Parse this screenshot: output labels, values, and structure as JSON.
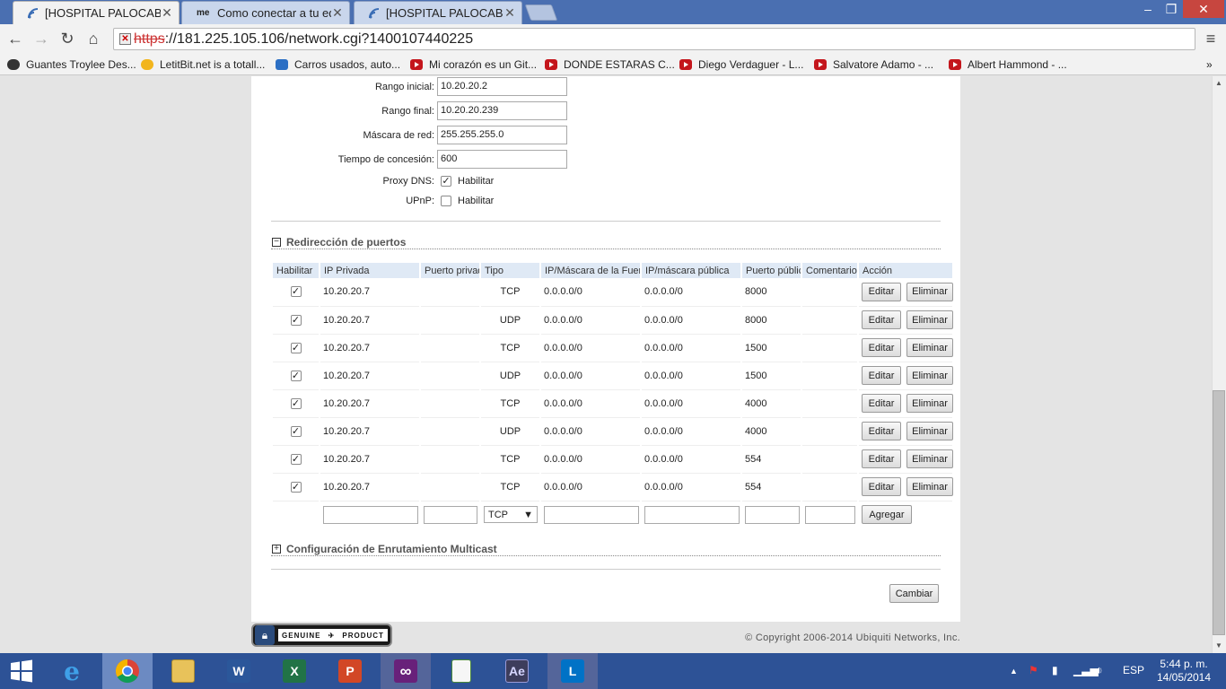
{
  "browser": {
    "tabs": [
      {
        "title": "[HOSPITAL PALOCABILDO",
        "icon": "signal-icon",
        "active": true
      },
      {
        "title": "Como conectar a tu equip",
        "icon": "me-icon",
        "active": false
      },
      {
        "title": "[HOSPITAL PALOCABILDO",
        "icon": "signal-icon",
        "active": false
      }
    ],
    "window_controls": {
      "minimize": "–",
      "restore": "❐",
      "close": "✕"
    },
    "url_protocol": "https",
    "url_rest": "://181.225.105.106/network.cgi?1400107440225",
    "bookmarks": [
      "Guantes Troylee Des...",
      "LetitBit.net is a totall...",
      "Carros usados, auto...",
      "Mi corazón es un Git...",
      "DONDE ESTARAS C...",
      "Diego Verdaguer - L...",
      "Salvatore Adamo - ...",
      "Albert Hammond - ..."
    ],
    "bookmarks_overflow": "»"
  },
  "dhcp": {
    "range_start_label": "Rango inicial:",
    "range_start_value": "10.20.20.2",
    "range_end_label": "Rango final:",
    "range_end_value": "10.20.20.239",
    "netmask_label": "Máscara de red:",
    "netmask_value": "255.255.255.0",
    "lease_label": "Tiempo de concesión:",
    "lease_value": "600",
    "dns_proxy_label": "Proxy DNS:",
    "dns_proxy_checked": true,
    "upnp_label": "UPnP:",
    "upnp_checked": false,
    "enable_text": "Habilitar"
  },
  "port_forward": {
    "section_title": "Redirección de puertos",
    "headers": [
      "Habilitar",
      "IP Privada",
      "Puerto privado",
      "Tipo",
      "IP/Máscara de la Fuente",
      "IP/máscara pública",
      "Puerto público",
      "Comentario",
      "Acción"
    ],
    "rows": [
      {
        "enabled": true,
        "ip": "10.20.20.7",
        "private_port": "",
        "type": "TCP",
        "source": "0.0.0.0/0",
        "public_ip": "0.0.0.0/0",
        "public_port": "8000",
        "comment": ""
      },
      {
        "enabled": true,
        "ip": "10.20.20.7",
        "private_port": "",
        "type": "UDP",
        "source": "0.0.0.0/0",
        "public_ip": "0.0.0.0/0",
        "public_port": "8000",
        "comment": ""
      },
      {
        "enabled": true,
        "ip": "10.20.20.7",
        "private_port": "",
        "type": "TCP",
        "source": "0.0.0.0/0",
        "public_ip": "0.0.0.0/0",
        "public_port": "1500",
        "comment": ""
      },
      {
        "enabled": true,
        "ip": "10.20.20.7",
        "private_port": "",
        "type": "UDP",
        "source": "0.0.0.0/0",
        "public_ip": "0.0.0.0/0",
        "public_port": "1500",
        "comment": ""
      },
      {
        "enabled": true,
        "ip": "10.20.20.7",
        "private_port": "",
        "type": "TCP",
        "source": "0.0.0.0/0",
        "public_ip": "0.0.0.0/0",
        "public_port": "4000",
        "comment": ""
      },
      {
        "enabled": true,
        "ip": "10.20.20.7",
        "private_port": "",
        "type": "UDP",
        "source": "0.0.0.0/0",
        "public_ip": "0.0.0.0/0",
        "public_port": "4000",
        "comment": ""
      },
      {
        "enabled": true,
        "ip": "10.20.20.7",
        "private_port": "",
        "type": "TCP",
        "source": "0.0.0.0/0",
        "public_ip": "0.0.0.0/0",
        "public_port": "554",
        "comment": ""
      },
      {
        "enabled": true,
        "ip": "10.20.20.7",
        "private_port": "",
        "type": "TCP",
        "source": "0.0.0.0/0",
        "public_ip": "0.0.0.0/0",
        "public_port": "554",
        "comment": ""
      }
    ],
    "edit_label": "Editar",
    "delete_label": "Eliminar",
    "new_type_value": "TCP",
    "add_label": "Agregar"
  },
  "multicast": {
    "section_title": "Configuración de Enrutamiento Multicast"
  },
  "change_label": "Cambiar",
  "footer": {
    "genuine_left": "GENUINE",
    "genuine_right": "PRODUCT",
    "copyright": "© Copyright 2006-2014 Ubiquiti Networks, Inc."
  },
  "taskbar": {
    "apps": [
      "Internet Explorer",
      "Chrome",
      "File Explorer",
      "Word",
      "Excel",
      "PowerPoint",
      "Visual Studio",
      "Notepad",
      "Adobe After Effects",
      "Lync"
    ],
    "ae_label": "Ae",
    "lang": "ESP",
    "time": "5:44 p. m.",
    "date": "14/05/2014"
  }
}
